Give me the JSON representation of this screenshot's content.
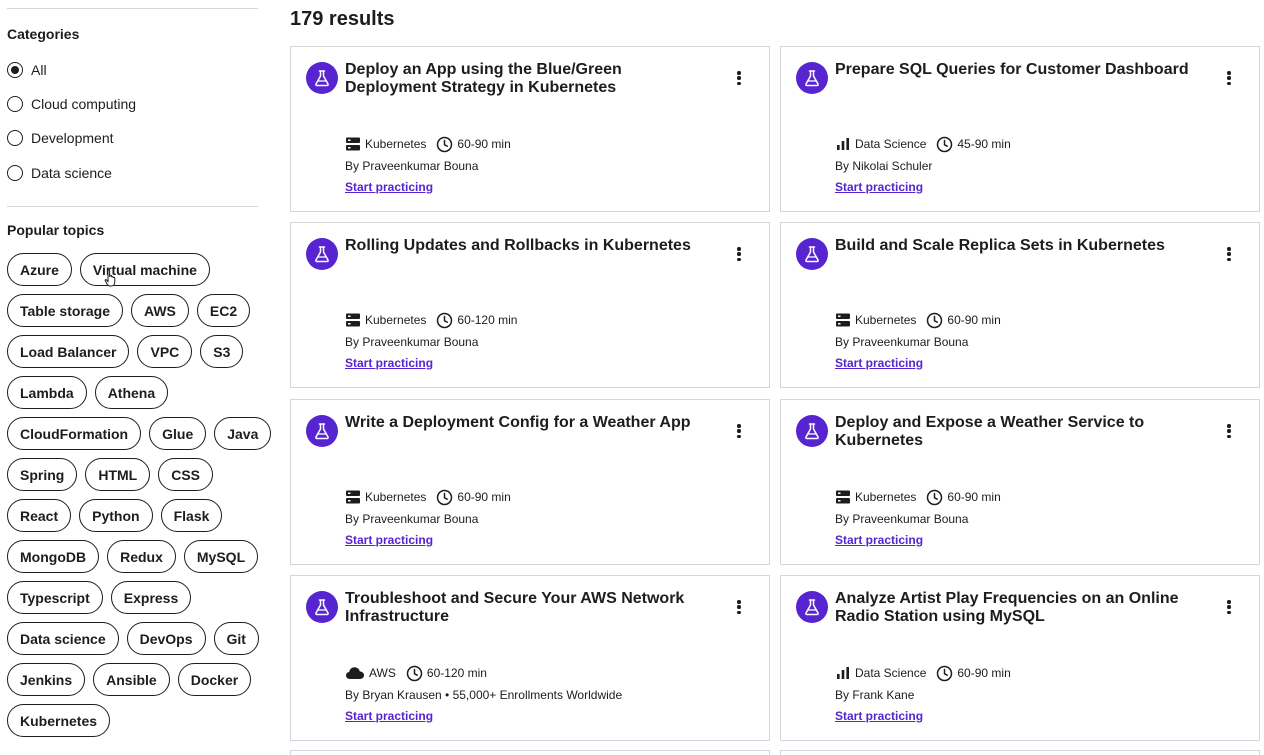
{
  "sidebar": {
    "categories_title": "Categories",
    "categories": [
      {
        "label": "All",
        "checked": true
      },
      {
        "label": "Cloud computing",
        "checked": false
      },
      {
        "label": "Development",
        "checked": false
      },
      {
        "label": "Data science",
        "checked": false
      }
    ],
    "popular_title": "Popular topics",
    "topic_rows": [
      [
        "Azure",
        "Virtual machine"
      ],
      [
        "Table storage",
        "AWS",
        "EC2"
      ],
      [
        "Load Balancer",
        "VPC",
        "S3"
      ],
      [
        "Lambda",
        "Athena"
      ],
      [
        "CloudFormation",
        "Glue",
        "Java"
      ],
      [
        "Spring",
        "HTML",
        "CSS"
      ],
      [
        "React",
        "Python",
        "Flask"
      ],
      [
        "MongoDB",
        "Redux",
        "MySQL"
      ],
      [
        "Typescript",
        "Express"
      ],
      [
        "Data science",
        "DevOps",
        "Git"
      ],
      [
        "Jenkins",
        "Ansible",
        "Docker"
      ],
      [
        "Kubernetes"
      ]
    ]
  },
  "results_label": "179 results",
  "cards": [
    {
      "title": "Deploy an App using the Blue/Green Deployment Strategy in Kubernetes",
      "category_icon": "kubernetes-icon",
      "category": "Kubernetes",
      "duration": "60-90 min",
      "author": "By Praveenkumar Bouna",
      "cta": "Start practicing"
    },
    {
      "title": "Prepare SQL Queries for Customer Dashboard",
      "category_icon": "data-science-icon",
      "category": "Data Science",
      "duration": "45-90 min",
      "author": "By Nikolai Schuler",
      "cta": "Start practicing"
    },
    {
      "title": "Rolling Updates and Rollbacks in Kubernetes",
      "category_icon": "kubernetes-icon",
      "category": "Kubernetes",
      "duration": "60-120 min",
      "author": "By Praveenkumar Bouna",
      "cta": "Start practicing"
    },
    {
      "title": "Build and Scale Replica Sets in Kubernetes",
      "category_icon": "kubernetes-icon",
      "category": "Kubernetes",
      "duration": "60-90 min",
      "author": "By Praveenkumar Bouna",
      "cta": "Start practicing"
    },
    {
      "title": "Write a Deployment Config for a Weather App",
      "category_icon": "kubernetes-icon",
      "category": "Kubernetes",
      "duration": "60-90 min",
      "author": "By Praveenkumar Bouna",
      "cta": "Start practicing"
    },
    {
      "title": "Deploy and Expose a Weather Service to Kubernetes",
      "category_icon": "kubernetes-icon",
      "category": "Kubernetes",
      "duration": "60-90 min",
      "author": "By Praveenkumar Bouna",
      "cta": "Start practicing"
    },
    {
      "title": "Troubleshoot and Secure Your AWS Network Infrastructure",
      "category_icon": "cloud-icon",
      "category": "AWS",
      "duration": "60-120 min",
      "author": "By Bryan Krausen • 55,000+ Enrollments Worldwide",
      "cta": "Start practicing"
    },
    {
      "title": "Analyze Artist Play Frequencies on an Online Radio Station using MySQL",
      "category_icon": "data-science-icon",
      "category": "Data Science",
      "duration": "60-90 min",
      "author": "By Frank Kane",
      "cta": "Start practicing"
    }
  ],
  "colors": {
    "accent": "#5624d0",
    "text": "#1c1d1f",
    "border": "#d1d7dc"
  }
}
